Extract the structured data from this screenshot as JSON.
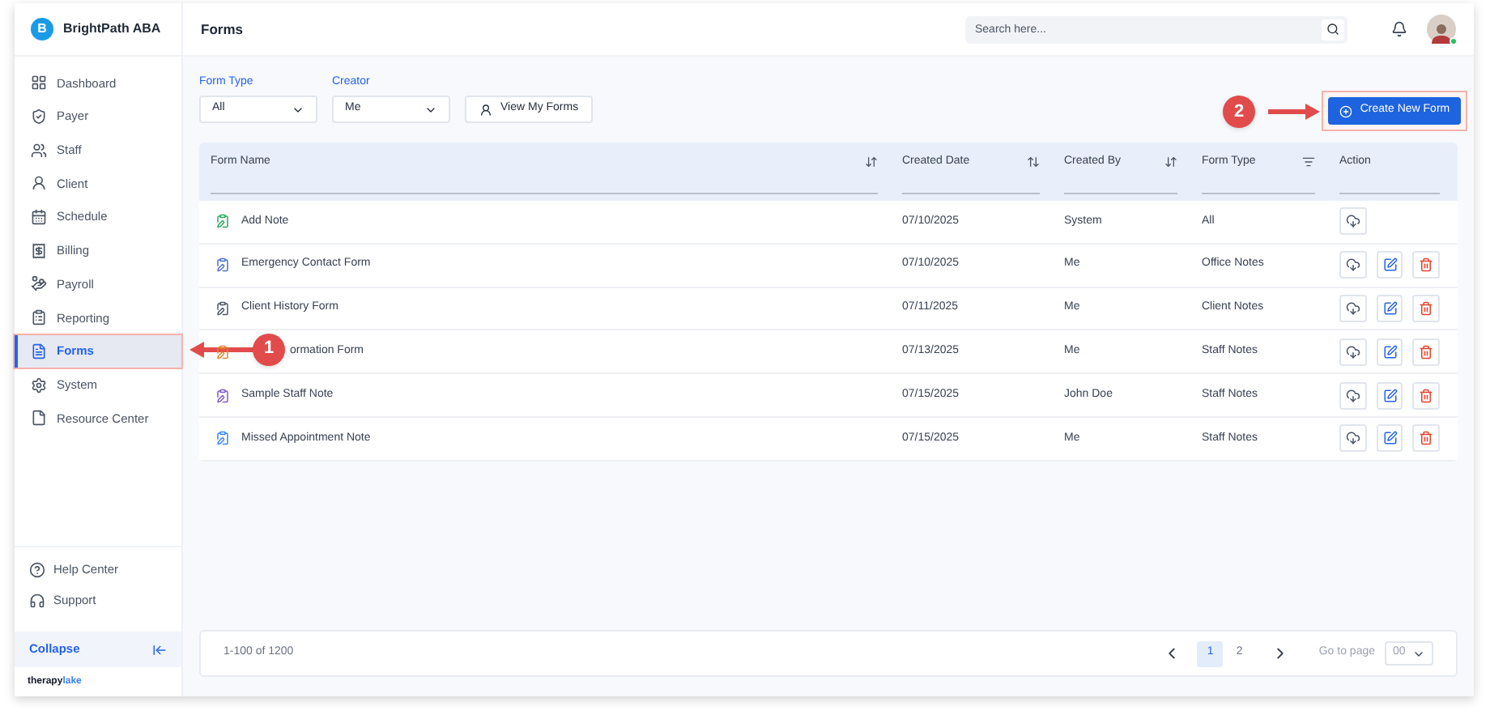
{
  "brand": {
    "initial": "B",
    "name": "BrightPath ABA"
  },
  "sidebar": {
    "items": [
      {
        "label": "Dashboard",
        "selected": false,
        "highlighted": false
      },
      {
        "label": "Payer",
        "selected": false,
        "highlighted": false
      },
      {
        "label": "Staff",
        "selected": false,
        "highlighted": false
      },
      {
        "label": "Client",
        "selected": false,
        "highlighted": false
      },
      {
        "label": "Schedule",
        "selected": false,
        "highlighted": false
      },
      {
        "label": "Billing",
        "selected": false,
        "highlighted": false
      },
      {
        "label": "Payroll",
        "selected": false,
        "highlighted": false
      },
      {
        "label": "Reporting",
        "selected": false,
        "highlighted": false
      },
      {
        "label": "Forms",
        "selected": true,
        "highlighted": true,
        "callout": "1"
      },
      {
        "label": "System",
        "selected": false,
        "highlighted": false
      },
      {
        "label": "Resource Center",
        "selected": false,
        "highlighted": false
      }
    ],
    "bottom_items": [
      {
        "label": "Help Center"
      },
      {
        "label": "Support"
      }
    ],
    "collapse": "Collapse",
    "logo": {
      "part_1": "therapy",
      "part_2": "lake"
    }
  },
  "header": {
    "title": "Forms",
    "search": {
      "placeholder": "Search here..."
    },
    "user_online": true
  },
  "filters": [
    {
      "label": "Form Type",
      "value": "All"
    },
    {
      "label": "Creator",
      "value": "Me"
    }
  ],
  "view_my_forms": "View My Forms",
  "create_button": {
    "label": "Create New Form",
    "highlighted": true,
    "callout": "2"
  },
  "table": {
    "columns": [
      {
        "label": "Form Name",
        "kind": "sort"
      },
      {
        "label": "Created Date",
        "kind": "sort-alt"
      },
      {
        "label": "Created By",
        "kind": "sort"
      },
      {
        "label": "Form Type",
        "kind": "filter"
      },
      {
        "label": "Action",
        "kind": "plain"
      }
    ],
    "rows": [
      {
        "name": "Add Note",
        "color": "#2fa45f",
        "date": "07/10/2025",
        "created_by": "System",
        "form_type": "All",
        "editable": false
      },
      {
        "name": "Emergency Contact Form",
        "color": "#4b6fd1",
        "date": "07/10/2025",
        "created_by": "Me",
        "form_type": "Office Notes",
        "editable": true
      },
      {
        "name": "Client History Form",
        "color": "#4b5563",
        "date": "07/11/2025",
        "created_by": "Me",
        "form_type": "Client Notes",
        "editable": true
      },
      {
        "name": "ormation Form",
        "color": "#e0862b",
        "date": "07/13/2025",
        "created_by": "Me",
        "form_type": "Staff Notes",
        "editable": true
      },
      {
        "name": "Sample Staff Note",
        "color": "#7c5cc4",
        "date": "07/15/2025",
        "created_by": "John Doe",
        "form_type": "Staff Notes",
        "editable": true
      },
      {
        "name": "Missed Appointment Note",
        "color": "#3b82f6",
        "date": "07/15/2025",
        "created_by": "Me",
        "form_type": "Staff Notes",
        "editable": true
      }
    ]
  },
  "pagination": {
    "range": "1-100 of 1200",
    "pages": [
      {
        "label": "1",
        "selected": true
      },
      {
        "label": "2",
        "selected": false
      }
    ],
    "go_to_label": "Go to page",
    "go_to_value": "00"
  }
}
